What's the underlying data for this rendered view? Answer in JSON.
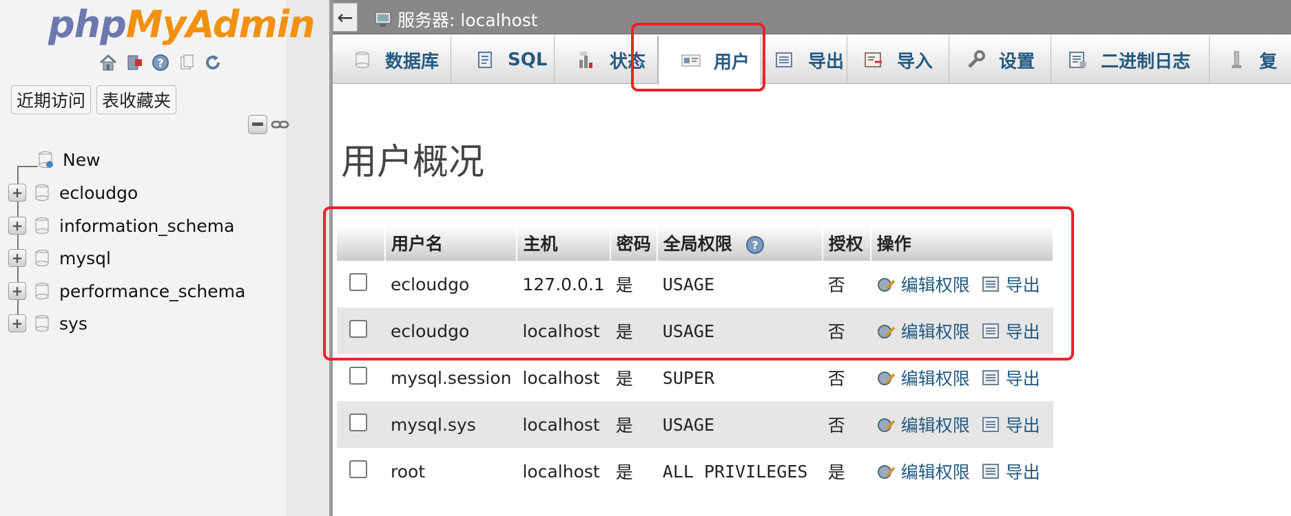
{
  "sidebar": {
    "logo": {
      "php": "php",
      "my": "My",
      "admin": "Admin"
    },
    "nav_icons": [
      "home-icon",
      "exit-icon",
      "help-icon",
      "docs-icon",
      "reload-icon"
    ],
    "buttons": {
      "recent": "近期访问",
      "favorites": "表收藏夹"
    },
    "tree": {
      "new_label": "New",
      "databases": [
        "ecloudgo",
        "information_schema",
        "mysql",
        "performance_schema",
        "sys"
      ]
    }
  },
  "topbar": {
    "back_symbol": "←",
    "breadcrumb": "服务器: localhost"
  },
  "tabs": [
    {
      "label": "数据库",
      "icon": "database-icon"
    },
    {
      "label": "SQL",
      "icon": "sql-icon"
    },
    {
      "label": "状态",
      "icon": "status-icon"
    },
    {
      "label": "用户",
      "icon": "users-icon"
    },
    {
      "label": "导出",
      "icon": "export-icon"
    },
    {
      "label": "导入",
      "icon": "import-icon"
    },
    {
      "label": "设置",
      "icon": "settings-icon"
    },
    {
      "label": "二进制日志",
      "icon": "binlog-icon"
    },
    {
      "label": "复",
      "icon": "replication-icon"
    }
  ],
  "page": {
    "title": "用户概况"
  },
  "user_table": {
    "headers": {
      "username": "用户名",
      "host": "主机",
      "password": "密码",
      "global_privileges": "全局权限",
      "grant": "授权",
      "action": "操作"
    },
    "action_labels": {
      "edit": "编辑权限",
      "export": "导出"
    },
    "rows": [
      {
        "username": "ecloudgo",
        "host": "127.0.0.1",
        "password": "是",
        "privileges": "USAGE",
        "grant": "否"
      },
      {
        "username": "ecloudgo",
        "host": "localhost",
        "password": "是",
        "privileges": "USAGE",
        "grant": "否"
      },
      {
        "username": "mysql.session",
        "host": "localhost",
        "password": "是",
        "privileges": "SUPER",
        "grant": "否"
      },
      {
        "username": "mysql.sys",
        "host": "localhost",
        "password": "是",
        "privileges": "USAGE",
        "grant": "否"
      },
      {
        "username": "root",
        "host": "localhost",
        "password": "是",
        "privileges": "ALL PRIVILEGES",
        "grant": "是"
      }
    ]
  },
  "colors": {
    "accent": "#235a81",
    "highlight": "#e8232a",
    "logo_orange": "#f29111",
    "logo_blue": "#6c78af"
  }
}
